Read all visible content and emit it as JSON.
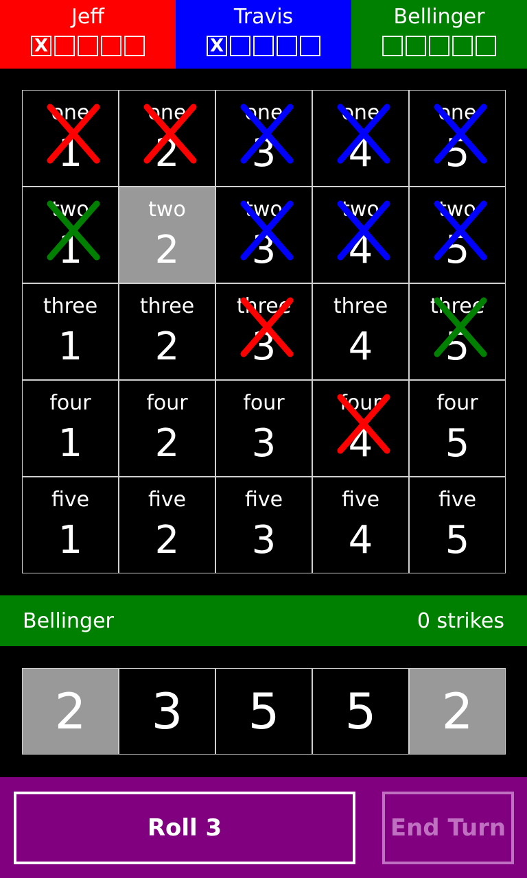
{
  "colors": {
    "red": "#ff0000",
    "blue": "#0000ff",
    "green": "#008000",
    "purple": "#800080",
    "selected": "#999999",
    "grid_line": "#cfcfcf"
  },
  "players": [
    {
      "name": "Jeff",
      "color": "#ff0000",
      "strikes": 1,
      "max_strikes": 5,
      "strike_symbol": "X"
    },
    {
      "name": "Travis",
      "color": "#0000ff",
      "strikes": 1,
      "max_strikes": 5,
      "strike_symbol": "X"
    },
    {
      "name": "Bellinger",
      "color": "#008000",
      "strikes": 0,
      "max_strikes": 5,
      "strike_symbol": "X"
    }
  ],
  "board": [
    {
      "word": "one",
      "cells": [
        {
          "n": "1",
          "mark": "red"
        },
        {
          "n": "2",
          "mark": "red"
        },
        {
          "n": "3",
          "mark": "blue"
        },
        {
          "n": "4",
          "mark": "blue"
        },
        {
          "n": "5",
          "mark": "blue"
        }
      ]
    },
    {
      "word": "two",
      "cells": [
        {
          "n": "1",
          "mark": "green"
        },
        {
          "n": "2",
          "mark": null,
          "selected": true
        },
        {
          "n": "3",
          "mark": "blue"
        },
        {
          "n": "4",
          "mark": "blue"
        },
        {
          "n": "5",
          "mark": "blue"
        }
      ]
    },
    {
      "word": "three",
      "cells": [
        {
          "n": "1",
          "mark": null
        },
        {
          "n": "2",
          "mark": null
        },
        {
          "n": "3",
          "mark": "red"
        },
        {
          "n": "4",
          "mark": null
        },
        {
          "n": "5",
          "mark": "green"
        }
      ]
    },
    {
      "word": "four",
      "cells": [
        {
          "n": "1",
          "mark": null
        },
        {
          "n": "2",
          "mark": null
        },
        {
          "n": "3",
          "mark": null
        },
        {
          "n": "4",
          "mark": "red"
        },
        {
          "n": "5",
          "mark": null
        }
      ]
    },
    {
      "word": "five",
      "cells": [
        {
          "n": "1",
          "mark": null
        },
        {
          "n": "2",
          "mark": null
        },
        {
          "n": "3",
          "mark": null
        },
        {
          "n": "4",
          "mark": null
        },
        {
          "n": "5",
          "mark": null
        }
      ]
    }
  ],
  "turn": {
    "player": "Bellinger",
    "strikes_label": "0 strikes",
    "color": "#008000"
  },
  "dice": [
    {
      "value": "2",
      "held": true
    },
    {
      "value": "3",
      "held": false
    },
    {
      "value": "5",
      "held": false
    },
    {
      "value": "5",
      "held": false
    },
    {
      "value": "2",
      "held": true
    }
  ],
  "buttons": {
    "roll": "Roll 3",
    "end_turn": "End Turn"
  }
}
